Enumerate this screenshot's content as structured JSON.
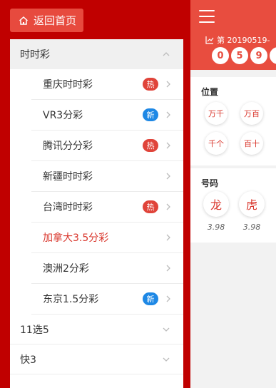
{
  "drawer": {
    "home_label": "返回首页",
    "sections": [
      {
        "title": "时时彩",
        "expanded": true,
        "items": [
          {
            "label": "重庆时时彩",
            "badge": "热",
            "badge_type": "hot"
          },
          {
            "label": "VR3分彩",
            "badge": "新",
            "badge_type": "new"
          },
          {
            "label": "腾讯分分彩",
            "badge": "热",
            "badge_type": "hot"
          },
          {
            "label": "新疆时时彩",
            "badge": "",
            "badge_type": ""
          },
          {
            "label": "台湾时时彩",
            "badge": "热",
            "badge_type": "hot"
          },
          {
            "label": "加拿大3.5分彩",
            "badge": "",
            "badge_type": "",
            "active": true
          },
          {
            "label": "澳洲2分彩",
            "badge": "",
            "badge_type": ""
          },
          {
            "label": "东京1.5分彩",
            "badge": "新",
            "badge_type": "new"
          }
        ]
      },
      {
        "title": "11选5",
        "expanded": false
      },
      {
        "title": "快3",
        "expanded": false
      }
    ]
  },
  "main": {
    "issue_text": "第 20190519-",
    "balls": [
      "0",
      "5",
      "9",
      ""
    ],
    "position_card": {
      "title": "位置",
      "options": [
        "万千",
        "万百",
        "千个",
        "百十"
      ]
    },
    "number_card": {
      "title": "号码",
      "options": [
        {
          "label": "龙",
          "odds": "3.98"
        },
        {
          "label": "虎",
          "odds": "3.98"
        }
      ]
    }
  },
  "colors": {
    "drawer_bg": "#c00000",
    "header_bg": "#e84d3f",
    "hot_badge": "#e0443a",
    "new_badge": "#1e88e5",
    "active_text": "#d9352b"
  }
}
